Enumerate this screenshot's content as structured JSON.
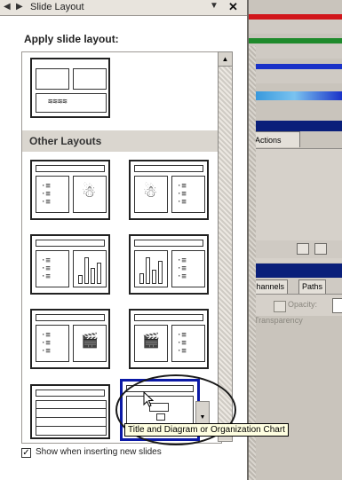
{
  "pane": {
    "title": "Slide Layout",
    "apply_label": "Apply slide layout:",
    "other_layouts_label": "Other Layouts",
    "checkbox_label": "Show when inserting new slides",
    "checkbox_checked": true
  },
  "tooltip": {
    "text": "Title and Diagram or Organization Chart"
  },
  "background_app": {
    "actions_tab": "Actions",
    "channels_tab": "Channels",
    "paths_tab": "Paths",
    "opacity_label": "Opacity:",
    "transparency_label": "Transparency",
    "color_bars": [
      "#d1161b",
      "#1f8a2c",
      "#1a32c8",
      "#2a8fd8"
    ]
  },
  "icons": [
    "settings-icon",
    "back-icon",
    "dropdown-icon",
    "close-icon",
    "scroll-up-icon",
    "scroll-down-icon",
    "cursor-icon",
    "checkmark-icon"
  ]
}
